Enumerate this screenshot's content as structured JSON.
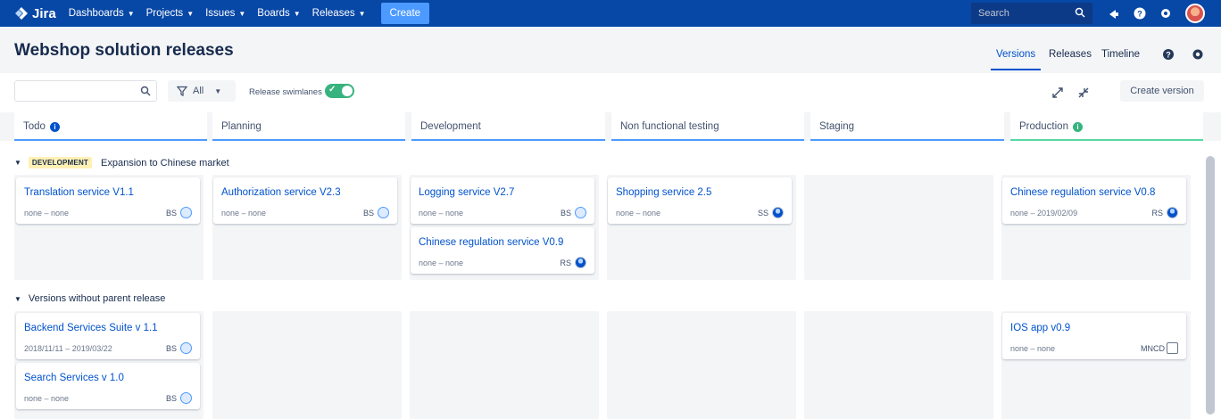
{
  "nav": {
    "logo": "Jira",
    "items": [
      {
        "label": "Dashboards"
      },
      {
        "label": "Projects"
      },
      {
        "label": "Issues"
      },
      {
        "label": "Boards"
      },
      {
        "label": "Releases"
      }
    ],
    "create_label": "Create",
    "search_placeholder": "Search"
  },
  "header": {
    "title": "Webshop solution releases",
    "tabs": [
      {
        "label": "Versions",
        "active": true
      },
      {
        "label": "Releases"
      },
      {
        "label": "Timeline"
      }
    ]
  },
  "toolbar": {
    "filter_label": "All",
    "swimlanes_label": "Release swimlanes",
    "swimlanes_on": true,
    "create_version_label": "Create version"
  },
  "columns": [
    {
      "name": "Todo",
      "info": true
    },
    {
      "name": "Planning"
    },
    {
      "name": "Development"
    },
    {
      "name": "Non functional testing"
    },
    {
      "name": "Staging"
    },
    {
      "name": "Production",
      "info": true
    }
  ],
  "swimlanes": [
    {
      "badge": "DEVELOPMENT",
      "title": "Expansion to Chinese market",
      "cards": [
        {
          "title": "Translation service V1.1",
          "dates": "none – none",
          "owner": "BS"
        },
        {
          "title": "Authorization service V2.3",
          "dates": "none – none",
          "owner": "BS"
        },
        {
          "title": "Logging service V2.7",
          "dates": "none – none",
          "owner": "BS"
        },
        {
          "title": "Chinese regulation service V0.9",
          "dates": "none – none",
          "owner": "RS"
        },
        {
          "title": "Shopping service 2.5",
          "dates": "none – none",
          "owner": "SS"
        },
        {
          "title": "Chinese regulation service V0.8",
          "dates": "none – 2019/02/09",
          "owner": "RS"
        }
      ]
    },
    {
      "title": "Versions without parent release",
      "cards": [
        {
          "title": "Backend Services Suite v 1.1",
          "dates": "2018/11/11 – 2019/03/22",
          "owner": "BS"
        },
        {
          "title": "Search Services v 1.0",
          "dates": "none – none",
          "owner": "BS"
        },
        {
          "title": "IOS app v0.9",
          "dates": "none – none",
          "owner": "MNCD"
        }
      ]
    }
  ],
  "colors": {
    "nav_bg": "#0747a6",
    "create_btn": "#4c9aff",
    "link": "#0052cc",
    "toggle_on": "#36b37e",
    "column_bar": "#4c9aff",
    "production_bar": "#57d9a3",
    "lozenge_bg": "#fff0b3"
  }
}
